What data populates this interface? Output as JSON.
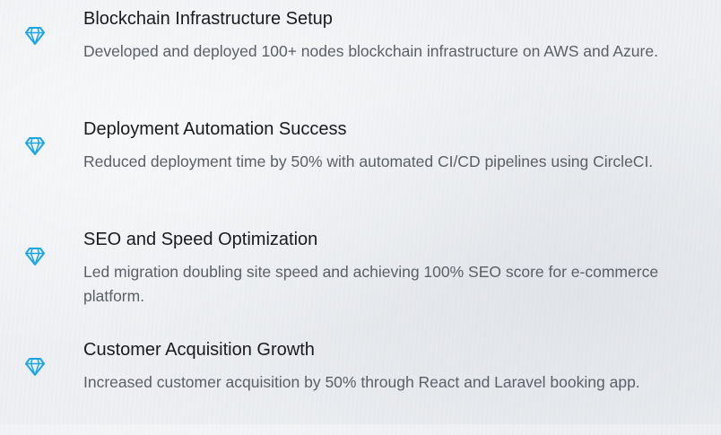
{
  "accent_color": "#1ba6e3",
  "icon": "diamond-icon",
  "achievements": [
    {
      "title": "Blockchain Infrastructure Setup",
      "description": "Developed and deployed 100+ nodes blockchain infrastructure on AWS and Azure."
    },
    {
      "title": "Deployment Automation Success",
      "description": "Reduced deployment time by 50% with automated CI/CD pipelines using CircleCI."
    },
    {
      "title": "SEO and Speed Optimization",
      "description": "Led migration doubling site speed and achieving 100% SEO score for e-commerce platform."
    },
    {
      "title": "Customer Acquisition Growth",
      "description": "Increased customer acquisition by 50% through React and Laravel booking app."
    }
  ]
}
